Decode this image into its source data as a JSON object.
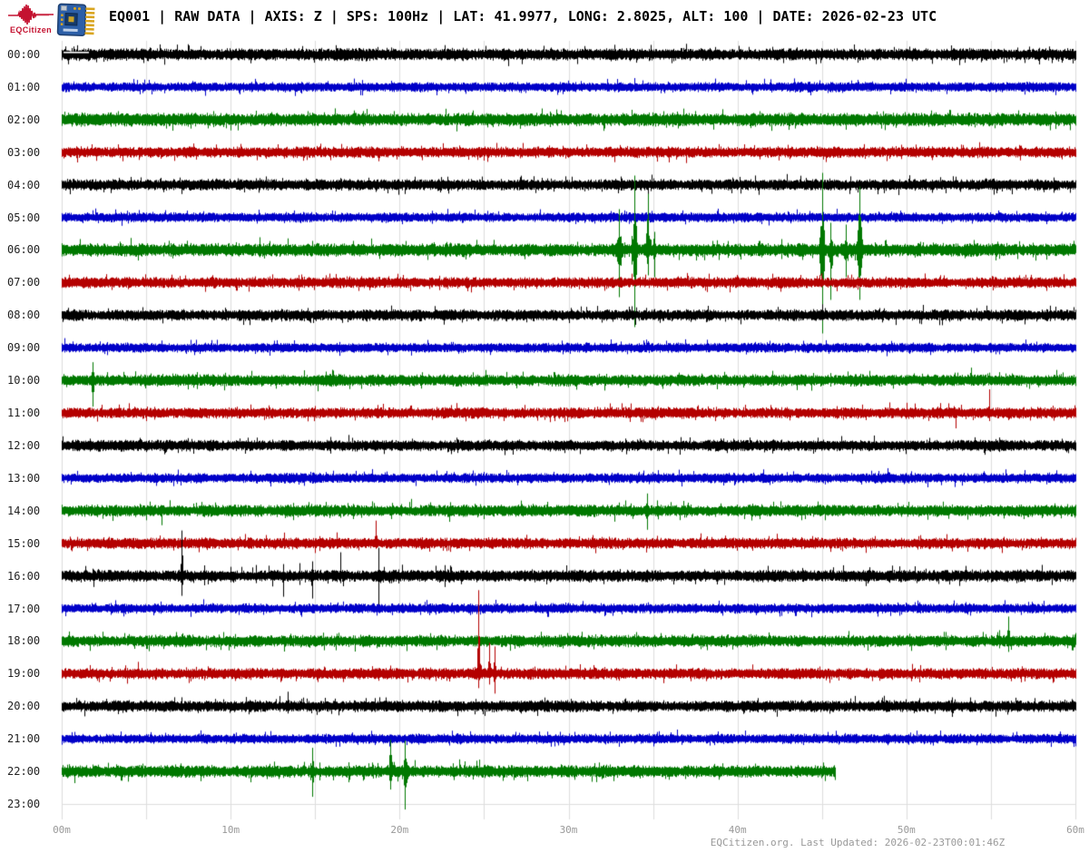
{
  "header": {
    "logo_text": "EQCitizen",
    "title": "EQ001 | RAW DATA | AXIS: Z | SPS: 100Hz | LAT: 41.9977, LONG: 2.8025, ALT: 100 | DATE: 2026-02-23 UTC"
  },
  "footer": {
    "text": "EQCitizen.org. Last Updated: 2026-02-23T00:01:46Z"
  },
  "chart_data": {
    "type": "line",
    "subtype": "helicorder-dayplot",
    "station": "EQ001",
    "axis": "Z",
    "sps": "100Hz",
    "date_utc": "2026-02-23",
    "minutes_per_row": 60,
    "grid_interval_min": 5,
    "x_axis": {
      "ticks": [
        "00m",
        "10m",
        "20m",
        "30m",
        "40m",
        "50m",
        "60m"
      ],
      "tick_minutes": [
        0,
        10,
        20,
        30,
        40,
        50,
        60
      ]
    },
    "palette": {
      "black": "#000000",
      "blue": "#0000C8",
      "green": "#007800",
      "red": "#B40000"
    },
    "grid_color": "#DDDDDD",
    "label_color": "#999999",
    "logo_color": "#C41230",
    "color_cycle": [
      "black",
      "blue",
      "green",
      "red"
    ],
    "rows": [
      {
        "hour": "00:00",
        "color": "black",
        "amp": 4.6,
        "end_min": 60,
        "flat_start": true,
        "events": []
      },
      {
        "hour": "01:00",
        "color": "blue",
        "amp": 3.7,
        "end_min": 60,
        "events": []
      },
      {
        "hour": "02:00",
        "color": "green",
        "amp": 5.0,
        "end_min": 60,
        "events": []
      },
      {
        "hour": "03:00",
        "color": "red",
        "amp": 4.2,
        "end_min": 60,
        "events": []
      },
      {
        "hour": "04:00",
        "color": "black",
        "amp": 4.3,
        "end_min": 60,
        "events": []
      },
      {
        "hour": "05:00",
        "color": "blue",
        "amp": 3.7,
        "end_min": 60,
        "events": []
      },
      {
        "hour": "06:00",
        "color": "green",
        "amp": 5.0,
        "end_min": 60,
        "events": [
          {
            "m": 11.7,
            "up": 14,
            "dn": 8
          },
          {
            "m": 23.5,
            "up": 7,
            "dn": 5
          },
          {
            "m": 30.5,
            "up": 9,
            "dn": 7
          },
          {
            "m": 33.0,
            "up": 45,
            "dn": 52,
            "w": 2
          },
          {
            "m": 33.9,
            "up": 82,
            "dn": 85,
            "w": 2
          },
          {
            "m": 34.7,
            "up": 62,
            "dn": 28,
            "w": 2
          },
          {
            "m": 35.1,
            "up": 20,
            "dn": 30
          },
          {
            "m": 38.5,
            "up": 10,
            "dn": 8
          },
          {
            "m": 42.6,
            "up": 12,
            "dn": 10
          },
          {
            "m": 45.0,
            "up": 85,
            "dn": 92,
            "w": 2
          },
          {
            "m": 45.5,
            "up": 30,
            "dn": 55,
            "w": 2
          },
          {
            "m": 46.4,
            "up": 28,
            "dn": 30,
            "w": 2
          },
          {
            "m": 47.2,
            "up": 70,
            "dn": 55,
            "w": 2
          },
          {
            "m": 50.8,
            "up": 9,
            "dn": 7
          },
          {
            "m": 54.0,
            "up": 11,
            "dn": 6
          },
          {
            "m": 57.5,
            "up": 8,
            "dn": 8
          }
        ]
      },
      {
        "hour": "07:00",
        "color": "red",
        "amp": 4.2,
        "end_min": 60,
        "events": [
          {
            "m": 51.1,
            "up": 10,
            "dn": 6
          }
        ]
      },
      {
        "hour": "08:00",
        "color": "black",
        "amp": 4.3,
        "end_min": 60,
        "events": [
          {
            "m": 34.6,
            "up": 8,
            "dn": 5
          },
          {
            "m": 45.0,
            "up": 12,
            "dn": 6
          }
        ]
      },
      {
        "hour": "09:00",
        "color": "blue",
        "amp": 3.7,
        "end_min": 60,
        "events": [
          {
            "m": 34.6,
            "up": 9,
            "dn": 5
          }
        ]
      },
      {
        "hour": "10:00",
        "color": "green",
        "amp": 4.5,
        "end_min": 60,
        "events": [
          {
            "m": 1.83,
            "up": 20,
            "dn": 29,
            "w": 2
          },
          {
            "m": 45.5,
            "up": 8,
            "dn": 6
          },
          {
            "m": 53.8,
            "up": 14,
            "dn": 6
          },
          {
            "m": 55.5,
            "up": 9,
            "dn": 5
          }
        ]
      },
      {
        "hour": "11:00",
        "color": "red",
        "amp": 4.2,
        "end_min": 60,
        "events": [
          {
            "m": 52.9,
            "up": 4,
            "dn": 17
          },
          {
            "m": 54.9,
            "up": 26,
            "dn": 9
          }
        ]
      },
      {
        "hour": "12:00",
        "color": "black",
        "amp": 4.3,
        "end_min": 60,
        "events": []
      },
      {
        "hour": "13:00",
        "color": "blue",
        "amp": 3.7,
        "end_min": 60,
        "events": [
          {
            "m": 0.9,
            "up": 8,
            "dn": 3
          }
        ]
      },
      {
        "hour": "14:00",
        "color": "green",
        "amp": 4.5,
        "end_min": 60,
        "events": [
          {
            "m": 5.9,
            "up": 6,
            "dn": 16
          },
          {
            "m": 20.7,
            "up": 13,
            "dn": 4
          },
          {
            "m": 33.7,
            "up": 8,
            "dn": 6
          },
          {
            "m": 34.65,
            "up": 19,
            "dn": 21,
            "w": 2
          },
          {
            "m": 39.0,
            "up": 8,
            "dn": 5
          }
        ]
      },
      {
        "hour": "15:00",
        "color": "red",
        "amp": 4.2,
        "end_min": 60,
        "events": [
          {
            "m": 16.3,
            "up": 12,
            "dn": 5
          },
          {
            "m": 18.6,
            "up": 25,
            "dn": 6
          }
        ]
      },
      {
        "hour": "16:00",
        "color": "black",
        "amp": 4.6,
        "end_min": 60,
        "events": [
          {
            "m": 7.09,
            "up": 50,
            "dn": 22
          },
          {
            "m": 10.0,
            "up": 10,
            "dn": 7
          },
          {
            "m": 11.5,
            "up": 12,
            "dn": 8
          },
          {
            "m": 13.1,
            "up": 13,
            "dn": 23
          },
          {
            "m": 14.1,
            "up": 14,
            "dn": 10
          },
          {
            "m": 14.8,
            "up": 16,
            "dn": 25
          },
          {
            "m": 16.5,
            "up": 26,
            "dn": 8
          },
          {
            "m": 18.75,
            "up": 31,
            "dn": 32
          }
        ]
      },
      {
        "hour": "17:00",
        "color": "blue",
        "amp": 3.7,
        "end_min": 60,
        "events": [
          {
            "m": 53.5,
            "up": 7,
            "dn": 4
          }
        ]
      },
      {
        "hour": "18:00",
        "color": "green",
        "amp": 4.5,
        "end_min": 60,
        "events": [
          {
            "m": 52.3,
            "up": 10,
            "dn": 10
          },
          {
            "m": 55.5,
            "up": 12,
            "dn": 8
          },
          {
            "m": 56.0,
            "up": 27,
            "dn": 12
          },
          {
            "m": 58.2,
            "up": 9,
            "dn": 5
          }
        ]
      },
      {
        "hour": "19:00",
        "color": "red",
        "amp": 4.2,
        "end_min": 60,
        "events": [
          {
            "m": 4.5,
            "up": 13,
            "dn": 6
          },
          {
            "m": 24.65,
            "up": 92,
            "dn": 16
          },
          {
            "m": 25.3,
            "up": 34,
            "dn": 12
          },
          {
            "m": 25.6,
            "up": 30,
            "dn": 22
          }
        ]
      },
      {
        "hour": "20:00",
        "color": "black",
        "amp": 4.4,
        "end_min": 60,
        "events": [
          {
            "m": 13.4,
            "up": 16,
            "dn": 8
          }
        ]
      },
      {
        "hour": "21:00",
        "color": "blue",
        "amp": 3.7,
        "end_min": 60,
        "events": [
          {
            "m": 50.6,
            "up": 9,
            "dn": 4
          }
        ]
      },
      {
        "hour": "22:00",
        "color": "green",
        "amp": 4.6,
        "end_min": 45.8,
        "events": [
          {
            "m": 14.8,
            "up": 26,
            "dn": 28,
            "w": 2
          },
          {
            "m": 17.0,
            "up": 10,
            "dn": 12
          },
          {
            "m": 19.45,
            "up": 35,
            "dn": 20,
            "w": 2
          },
          {
            "m": 20.3,
            "up": 34,
            "dn": 42,
            "w": 2
          }
        ]
      },
      {
        "hour": "23:00",
        "color": "black",
        "amp": 4.4,
        "end_min": 0,
        "events": []
      }
    ]
  }
}
